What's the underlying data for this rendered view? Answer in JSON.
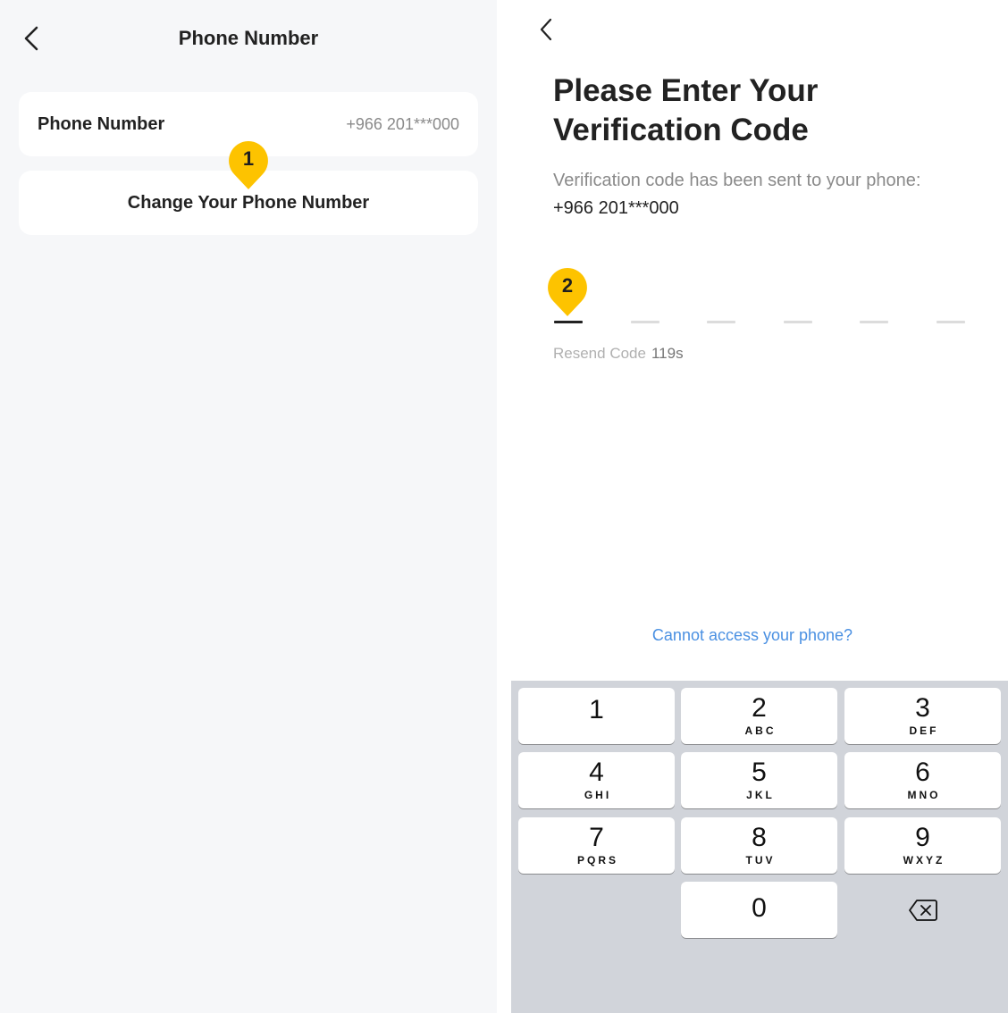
{
  "left_screen": {
    "back_icon": "chevron-left-icon",
    "title": "Phone Number",
    "phone_row": {
      "label": "Phone Number",
      "value": "+966 201***000"
    },
    "change_button_label": "Change Your Phone Number",
    "marker_label": "1"
  },
  "right_screen": {
    "back_icon": "chevron-left-icon",
    "headline_line1": "Please Enter Your",
    "headline_line2": "Verification Code",
    "subtitle": "Verification code has been sent to your phone:",
    "phone_number": "+966 201***000",
    "code_length": 6,
    "code_filled": 0,
    "marker_label": "2",
    "resend_label": "Resend Code",
    "resend_timer": "119s",
    "cannot_access_link": "Cannot access your phone?",
    "link_color": "#4a90e2"
  },
  "keyboard": {
    "keys": [
      {
        "digit": "1",
        "letters": ""
      },
      {
        "digit": "2",
        "letters": "ABC"
      },
      {
        "digit": "3",
        "letters": "DEF"
      },
      {
        "digit": "4",
        "letters": "GHI"
      },
      {
        "digit": "5",
        "letters": "JKL"
      },
      {
        "digit": "6",
        "letters": "MNO"
      },
      {
        "digit": "7",
        "letters": "PQRS"
      },
      {
        "digit": "8",
        "letters": "TUV"
      },
      {
        "digit": "9",
        "letters": "WXYZ"
      },
      {
        "digit": "0",
        "letters": ""
      }
    ],
    "delete_icon": "backspace-icon"
  },
  "colors": {
    "marker": "#fdc300",
    "keyboard_bg": "#d1d4da",
    "left_bg": "#f6f7f9"
  }
}
